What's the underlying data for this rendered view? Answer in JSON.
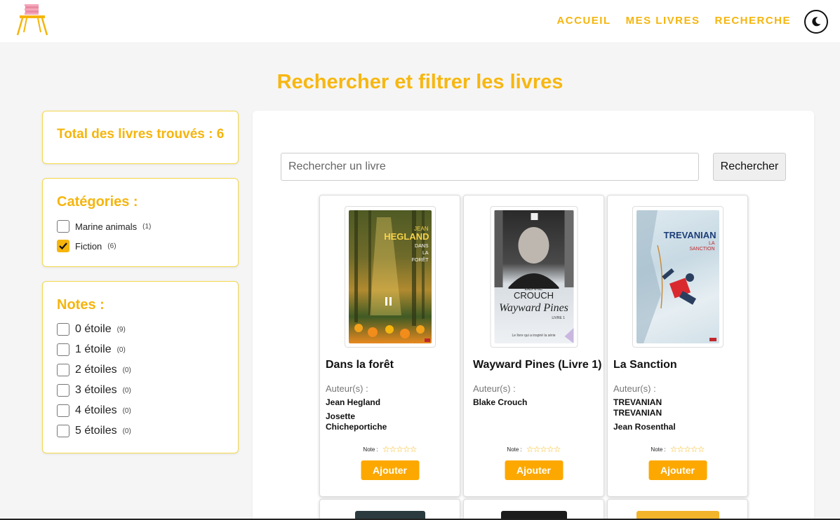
{
  "nav": {
    "items": [
      "ACCUEIL",
      "MES LIVRES",
      "RECHERCHE"
    ],
    "theme_toggle_icon": "moon-icon"
  },
  "page": {
    "title": "Rechercher et filtrer les livres"
  },
  "sidebar": {
    "total_label": "Total des livres trouvés : 6",
    "categories": {
      "title": "Catégories :",
      "items": [
        {
          "label": "Marine animals",
          "count": "(1)",
          "checked": false
        },
        {
          "label": "Fiction",
          "count": "(6)",
          "checked": true
        }
      ]
    },
    "notes": {
      "title": "Notes :",
      "items": [
        {
          "label": "0 étoile",
          "count": "(9)"
        },
        {
          "label": "1 étoile",
          "count": "(0)"
        },
        {
          "label": "2 étoiles",
          "count": "(0)"
        },
        {
          "label": "3 étoiles",
          "count": "(0)"
        },
        {
          "label": "4 étoiles",
          "count": "(0)"
        },
        {
          "label": "5 étoiles",
          "count": "(0)"
        }
      ]
    }
  },
  "search": {
    "placeholder": "Rechercher un livre",
    "button": "Rechercher"
  },
  "books": [
    {
      "title": "Dans la forêt",
      "authors_label": "Auteur(s) :",
      "authors": [
        "Jean Hegland",
        "Josette Chicheportiche"
      ],
      "note_label": "Note :",
      "stars": "☆☆☆☆☆",
      "add": "Ajouter",
      "cover": {
        "author": "JEAN HEGLAND",
        "title": "DANS LA FORÊT",
        "accent": "#e8b52a"
      }
    },
    {
      "title": "Wayward Pines (Livre 1)",
      "authors_label": "Auteur(s) :",
      "authors": [
        "Blake Crouch"
      ],
      "note_label": "Note :",
      "stars": "☆☆☆☆☆",
      "add": "Ajouter",
      "cover": {
        "author": "BLAKE CROUCH",
        "title": "Wayward Pines",
        "subtitle": "LIVRE 1",
        "tagline": "Le livre qui a inspiré la série"
      }
    },
    {
      "title": "La Sanction",
      "authors_label": "Auteur(s) :",
      "authors": [
        "TREVANIAN TREVANIAN",
        "Jean Rosenthal"
      ],
      "note_label": "Note :",
      "stars": "☆☆☆☆☆",
      "add": "Ajouter",
      "cover": {
        "author": "TREVANIAN",
        "title": "LA SANCTION"
      }
    }
  ],
  "colors": {
    "accent": "#f5b50d",
    "button": "#fca800"
  }
}
